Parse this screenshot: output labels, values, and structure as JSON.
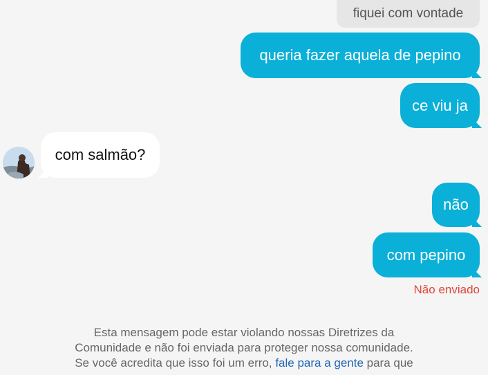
{
  "messages": {
    "context_label": "fiquei com vontade",
    "m1": "queria fazer aquela de pepino",
    "m2": "ce viu ja",
    "m3": "com salmão?",
    "m4": "não",
    "m5": "com pepino"
  },
  "status": {
    "not_sent": "Não enviado"
  },
  "notice": {
    "line1": "Esta mensagem pode estar violando nossas Diretrizes da",
    "line2": "Comunidade e não foi enviada para proteger nossa comunidade.",
    "line3_prefix": "Se você acredita que isso foi um erro, ",
    "line3_link": "fale para a gente",
    "line3_suffix": " para que"
  },
  "colors": {
    "sent_bubble": "#0ab0d8",
    "received_bubble": "#ffffff",
    "background": "#f5f5f5",
    "error_text": "#e0463a",
    "link": "#1f66b5"
  },
  "icons": {
    "avatar": "contact-avatar"
  }
}
